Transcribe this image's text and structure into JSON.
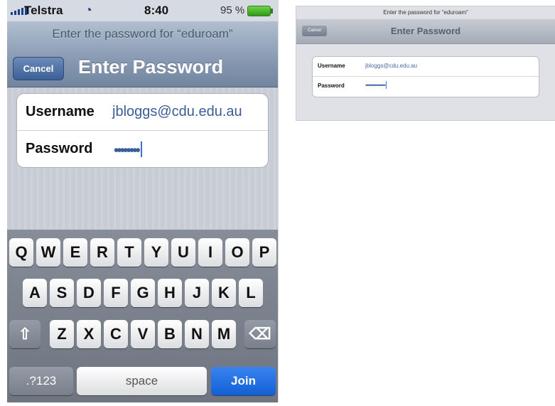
{
  "phone": {
    "status": {
      "carrier": "Telstra",
      "time": "8:40",
      "battery": "95 %"
    },
    "prompt": "Enter the password for “eduroam”",
    "cancel_label": "Cancel",
    "title": "Enter Password",
    "username_label": "Username",
    "username_value": "jbloggs@cdu.edu.au",
    "password_label": "Password",
    "password_mask": "••••••••",
    "keyboard": {
      "row1": [
        "Q",
        "W",
        "E",
        "R",
        "T",
        "Y",
        "U",
        "I",
        "O",
        "P"
      ],
      "row2": [
        "A",
        "S",
        "D",
        "F",
        "G",
        "H",
        "J",
        "K",
        "L"
      ],
      "row3": [
        "Z",
        "X",
        "C",
        "V",
        "B",
        "N",
        "M"
      ],
      "numbers_label": ".?123",
      "space_label": "space",
      "join_label": "Join"
    }
  },
  "ipad": {
    "prompt": "Enter the password for “eduroam”",
    "cancel_label": "Cancel",
    "title": "Enter Password",
    "username_label": "Username",
    "username_value": "jbloggs@cdu.edu.au",
    "password_label": "Password",
    "password_mask": "•••••••••••••"
  },
  "colors": {
    "accent": "#1260d6",
    "nav": "#8c9db5"
  }
}
